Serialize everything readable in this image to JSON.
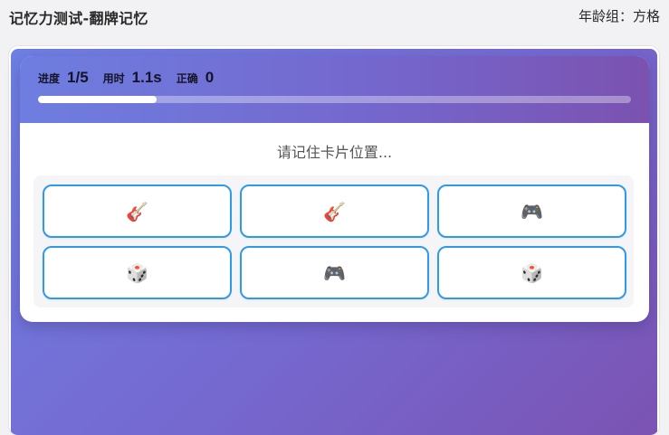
{
  "header": {
    "title": "记忆力测试-翻牌记忆",
    "age_group": "年龄组：方格"
  },
  "game": {
    "stats": {
      "progress_label": "进度",
      "progress_value": "1/5",
      "time_label": "用时",
      "time_value": "1.1s",
      "correct_label": "正确",
      "correct_value": "0"
    },
    "progress_fraction": 0.2,
    "instruction": "请记住卡片位置...",
    "cards": [
      {
        "icon": "guitar-icon",
        "glyph": "🎸"
      },
      {
        "icon": "guitar-icon",
        "glyph": "🎸"
      },
      {
        "icon": "game-controller-icon",
        "glyph": "🎮"
      },
      {
        "icon": "dice-icon",
        "glyph": "🎲"
      },
      {
        "icon": "game-controller-icon",
        "glyph": "🎮"
      },
      {
        "icon": "dice-icon",
        "glyph": "🎲"
      }
    ]
  },
  "colors": {
    "accent_border": "#2e9bea",
    "gradient_start": "#6e7ee0",
    "gradient_end": "#7b52b0"
  }
}
